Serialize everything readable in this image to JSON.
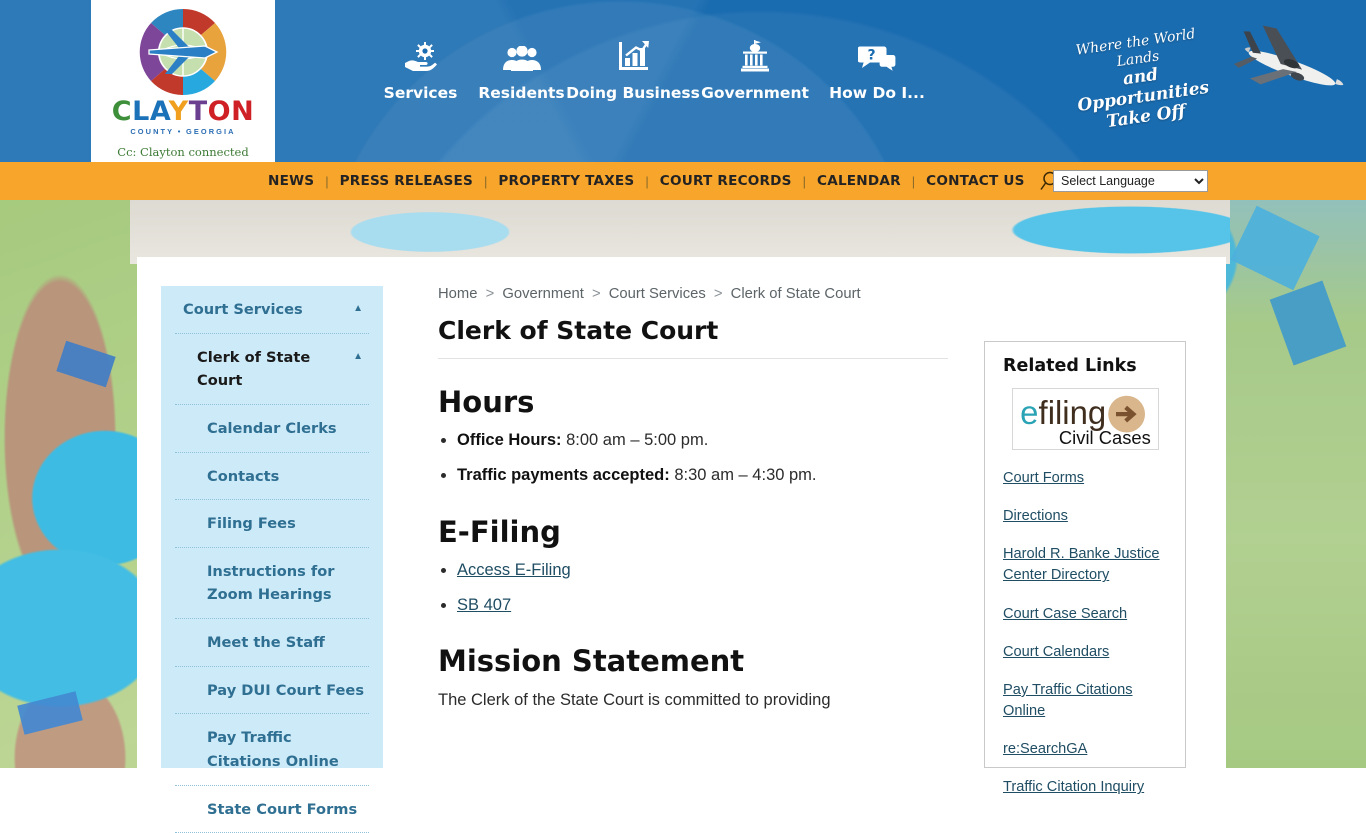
{
  "brand": {
    "logo_word_parts": [
      "C",
      "LA",
      "Y",
      "T",
      "ON"
    ],
    "logo_subtitle": "COUNTY • GEORGIA",
    "logo_tagline": "Cc: Clayton connected"
  },
  "header": {
    "nav": [
      {
        "label": "Services",
        "icon": "hand-gear-icon"
      },
      {
        "label": "Residents",
        "icon": "people-group-icon"
      },
      {
        "label": "Doing Business",
        "icon": "bar-chart-arrow-icon"
      },
      {
        "label": "Government",
        "icon": "classical-building-icon"
      },
      {
        "label": "How Do I...",
        "icon": "question-speech-bubble-icon"
      }
    ],
    "tagline": {
      "line1": "Where the World Lands",
      "line2": "and Opportunities",
      "line3": "Take Off"
    },
    "accent_blue": "#1a6cb0",
    "accent_orange": "#f7a52b"
  },
  "utility_bar": {
    "links": [
      "NEWS",
      "PRESS RELEASES",
      "PROPERTY TAXES",
      "COURT RECORDS",
      "CALENDAR",
      "CONTACT US"
    ],
    "separator": "|",
    "search_icon": "search-icon",
    "language": {
      "selected": "Select Language",
      "options": [
        "Select Language"
      ]
    }
  },
  "sidebar": {
    "items": [
      {
        "label": "Court Services",
        "level": 0,
        "caret": "▲",
        "active": false
      },
      {
        "label": "Clerk of State Court",
        "level": 1,
        "caret": "▲",
        "active": true
      },
      {
        "label": "Calendar Clerks",
        "level": 2,
        "caret": "",
        "active": false
      },
      {
        "label": "Contacts",
        "level": 2,
        "caret": "",
        "active": false
      },
      {
        "label": "Filing Fees",
        "level": 2,
        "caret": "",
        "active": false
      },
      {
        "label": "Instructions for Zoom Hearings",
        "level": 2,
        "caret": "",
        "active": false
      },
      {
        "label": "Meet the Staff",
        "level": 2,
        "caret": "",
        "active": false
      },
      {
        "label": "Pay DUI Court Fees",
        "level": 2,
        "caret": "",
        "active": false
      },
      {
        "label": "Pay Traffic Citations Online",
        "level": 2,
        "caret": "",
        "active": false
      },
      {
        "label": "State Court Forms",
        "level": 2,
        "caret": "",
        "active": false
      }
    ]
  },
  "main": {
    "breadcrumb": [
      "Home",
      "Government",
      "Court Services",
      "Clerk of State Court"
    ],
    "breadcrumb_separator": ">",
    "page_title": "Clerk of State Court",
    "sections": {
      "hours": {
        "heading": "Hours",
        "items": [
          {
            "label": "Office Hours:",
            "value": "8:00 am – 5:00 pm."
          },
          {
            "label": "Traffic payments accepted:",
            "value": "8:30 am – 4:30 pm."
          }
        ]
      },
      "efiling": {
        "heading": "E-Filing",
        "links": [
          "Access E-Filing",
          "SB 407"
        ]
      },
      "mission": {
        "heading": "Mission Statement",
        "text": "The Clerk of the State Court is committed to providing"
      }
    }
  },
  "related_links": {
    "heading": "Related Links",
    "logo": {
      "name": "efiling-civil-cases-logo",
      "text_e": "e",
      "text_filing": "filing",
      "text_sub": "Civil Cases",
      "color_e": "#2aa3b5",
      "color_filing": "#3f2d1e",
      "color_circle": "#d9b68b"
    },
    "links": [
      "Court Forms",
      "Directions",
      "Harold R. Banke Justice Center Directory",
      "Court Case Search",
      "Court Calendars",
      "Pay Traffic Citations Online",
      "re:SearchGA",
      "Traffic Citation Inquiry"
    ]
  }
}
